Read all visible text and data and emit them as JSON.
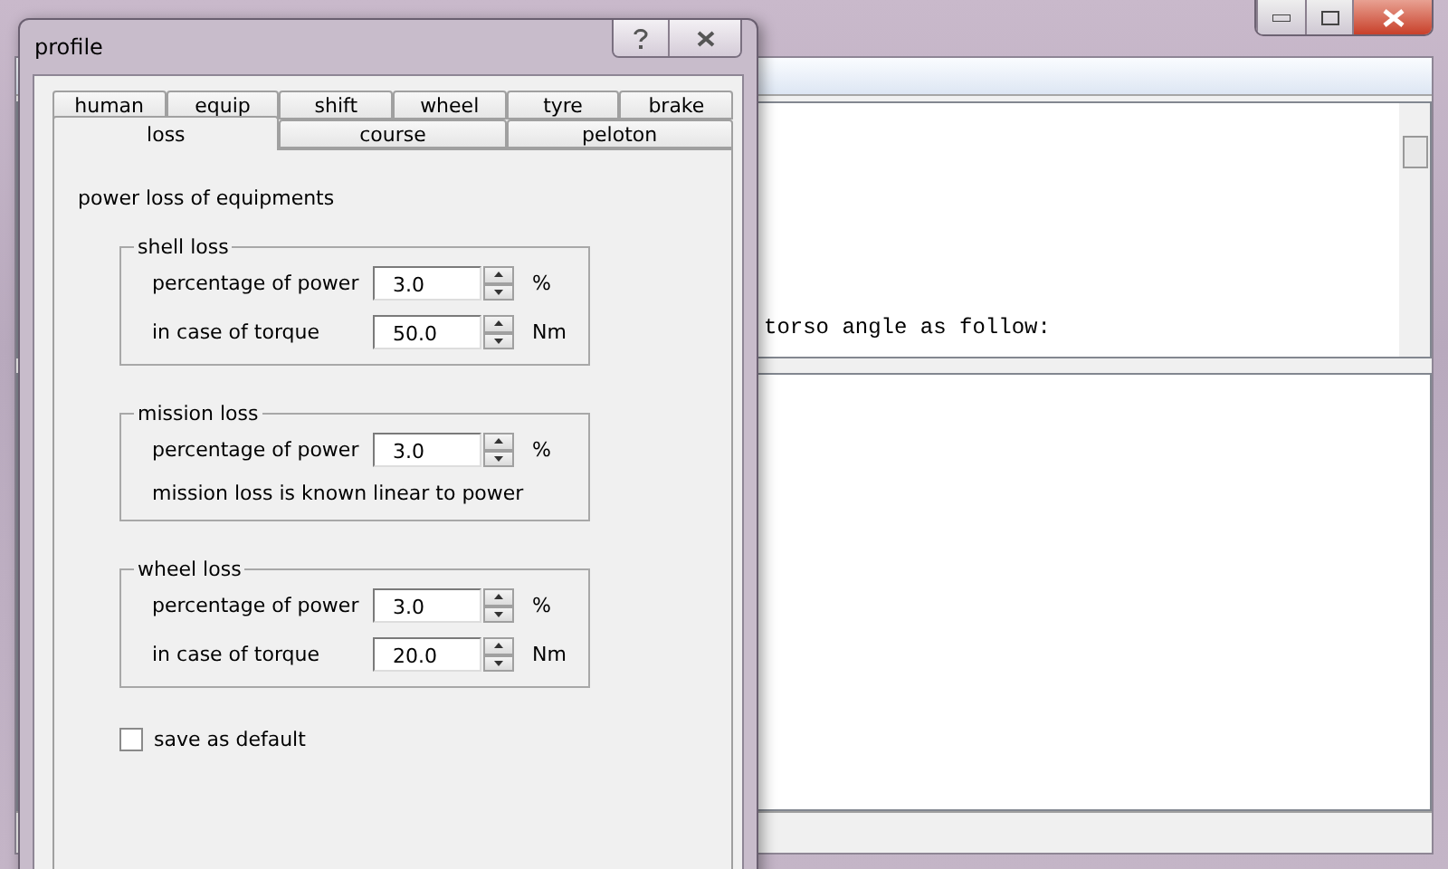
{
  "main_window": {
    "output_text": "torso angle as follow:"
  },
  "dialog": {
    "title": "profile",
    "tab_rows": [
      [
        {
          "label": "human",
          "selected": false
        },
        {
          "label": "equip",
          "selected": false
        },
        {
          "label": "shift",
          "selected": false
        },
        {
          "label": "wheel",
          "selected": false
        },
        {
          "label": "tyre",
          "selected": false
        },
        {
          "label": "brake",
          "selected": false
        }
      ],
      [
        {
          "label": "loss",
          "selected": true
        },
        {
          "label": "course",
          "selected": false
        },
        {
          "label": "peloton",
          "selected": false
        }
      ]
    ],
    "heading": "power loss of equipments",
    "groups": [
      {
        "title": "shell loss",
        "rows": [
          {
            "label": "percentage of power",
            "value": "3.0",
            "unit": "%"
          },
          {
            "label": "in case of torque",
            "value": "50.0",
            "unit": "Nm"
          }
        ]
      },
      {
        "title": "mission loss",
        "rows": [
          {
            "label": "percentage of power",
            "value": "3.0",
            "unit": "%"
          }
        ],
        "note": "mission loss is known linear to power"
      },
      {
        "title": "wheel loss",
        "rows": [
          {
            "label": "percentage of power",
            "value": "3.0",
            "unit": "%"
          },
          {
            "label": "in case of torque",
            "value": "20.0",
            "unit": "Nm"
          }
        ]
      }
    ],
    "save_default": {
      "label": "save as default",
      "checked": false
    }
  }
}
